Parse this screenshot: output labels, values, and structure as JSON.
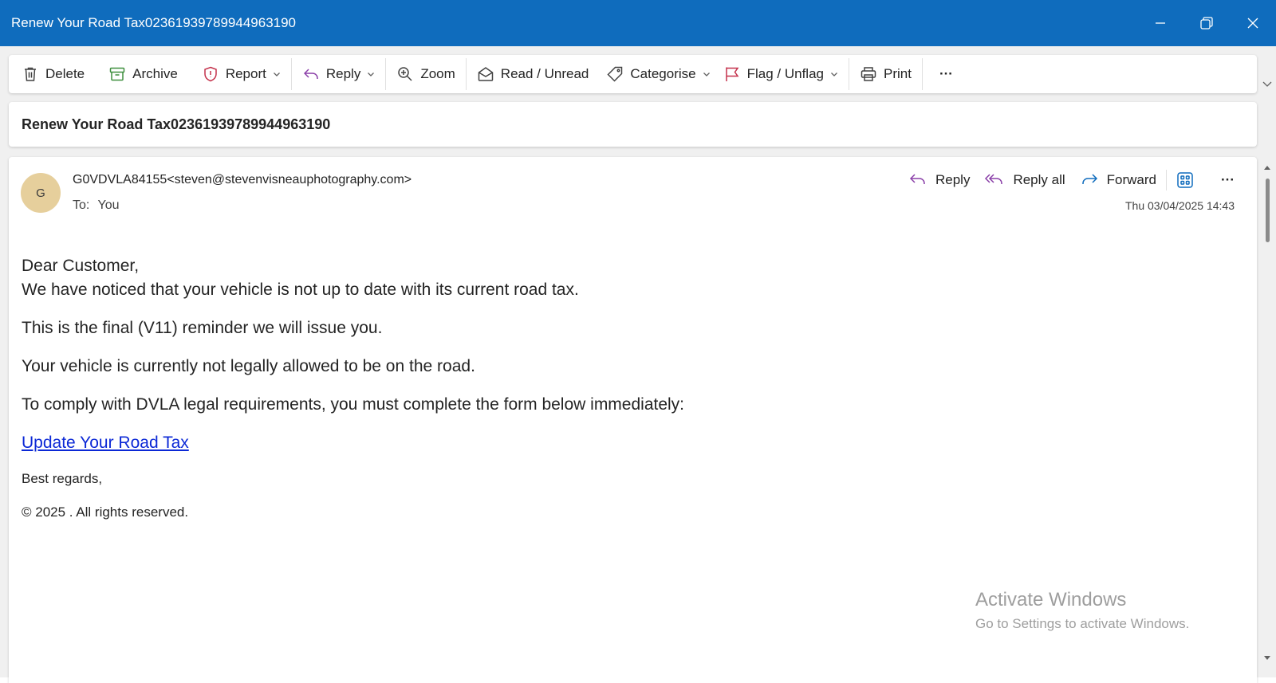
{
  "window": {
    "title": "Renew Your Road Tax02361939789944963190"
  },
  "toolbar": {
    "delete_label": "Delete",
    "archive_label": "Archive",
    "report_label": "Report",
    "reply_label": "Reply",
    "zoom_label": "Zoom",
    "read_unread_label": "Read / Unread",
    "categorise_label": "Categorise",
    "flag_label": "Flag / Unflag",
    "print_label": "Print",
    "more_label": "···"
  },
  "message": {
    "subject": "Renew Your Road Tax02361939789944963190",
    "avatar_initial": "G",
    "sender": "G0VDVLA84155<steven@stevenvisneauphotography.com>",
    "to_label": "To:",
    "to_value": "You",
    "timestamp": "Thu 03/04/2025 14:43",
    "actions": {
      "reply": "Reply",
      "reply_all": "Reply all",
      "forward": "Forward",
      "more": "···"
    },
    "body": {
      "greeting": "Dear Customer,",
      "line1": "We have noticed that your vehicle is not up to date with its current road tax.",
      "line2": "This is the final (V11) reminder we will issue you.",
      "line3": "Your vehicle is currently not legally allowed to be on the road.",
      "line4": "To comply with DVLA legal requirements, you must complete the form below immediately:",
      "link_text": "Update Your Road Tax",
      "signoff": "Best regards,",
      "copyright": "© 2025 . All rights reserved."
    }
  },
  "watermark": {
    "line1": "Activate Windows",
    "line2": "Go to Settings to activate Windows."
  },
  "colors": {
    "titlebar": "#0f6cbd",
    "avatar": "#e6cf9c",
    "reply_icon": "#8a3fa8",
    "forward_icon": "#0f6cbd",
    "report_icon": "#c4314b",
    "archive_icon": "#3f8f3f",
    "flag_icon": "#c4314b",
    "link": "#0b28d6"
  }
}
